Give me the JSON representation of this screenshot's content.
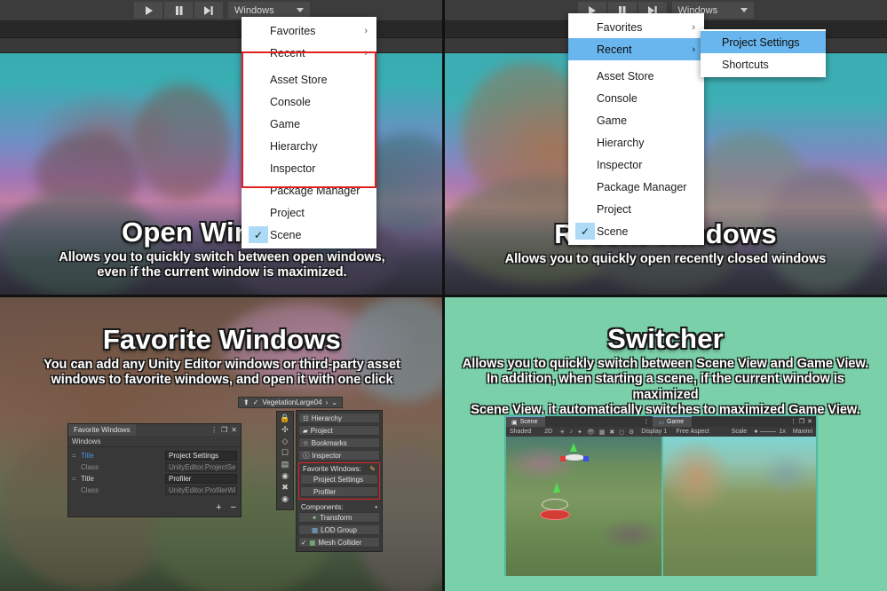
{
  "toolbar": {
    "play_label": "Play",
    "pause_label": "Pause",
    "step_label": "Step",
    "windows_button": "Windows"
  },
  "menus": {
    "open_windows": {
      "top_items": [
        {
          "label": "Favorites",
          "arrow": "›",
          "highlighted": false
        },
        {
          "label": "Recent",
          "arrow": "›",
          "highlighted": false
        }
      ],
      "window_items": [
        {
          "label": "Asset Store",
          "checked": false
        },
        {
          "label": "Console",
          "checked": false
        },
        {
          "label": "Game",
          "checked": false
        },
        {
          "label": "Hierarchy",
          "checked": false
        },
        {
          "label": "Inspector",
          "checked": false
        },
        {
          "label": "Package Manager",
          "checked": false
        },
        {
          "label": "Project",
          "checked": false
        },
        {
          "label": "Scene",
          "checked": true
        }
      ],
      "check_glyph": "✓",
      "highlight_color": "#69b6ef",
      "redbox_color": "#e02121"
    },
    "recent_windows": {
      "top_items": [
        {
          "label": "Favorites",
          "arrow": "›",
          "highlighted": false
        },
        {
          "label": "Recent",
          "arrow": "›",
          "highlighted": true
        }
      ],
      "window_items": [
        {
          "label": "Asset Store",
          "checked": false
        },
        {
          "label": "Console",
          "checked": false
        },
        {
          "label": "Game",
          "checked": false
        },
        {
          "label": "Hierarchy",
          "checked": false
        },
        {
          "label": "Inspector",
          "checked": false
        },
        {
          "label": "Package Manager",
          "checked": false
        },
        {
          "label": "Project",
          "checked": false
        },
        {
          "label": "Scene",
          "checked": true
        }
      ],
      "submenu": [
        {
          "label": "Project Settings",
          "highlighted": true
        },
        {
          "label": "Shortcuts",
          "highlighted": false
        }
      ]
    }
  },
  "panels": {
    "top_left": {
      "title": "Open Windows",
      "subtitle_line1": "Allows you to quickly switch between open windows,",
      "subtitle_line2": "even if the current window is maximized."
    },
    "top_right": {
      "title": "Recent Windows",
      "subtitle_line1": "Allows you to quickly open recently closed windows",
      "subtitle_line2": ""
    },
    "bottom_left": {
      "title": "Favorite Windows",
      "subtitle_line1": "You can add any Unity Editor windows or third-party asset",
      "subtitle_line2": "windows to favorite windows, and open it with one click"
    },
    "bottom_right": {
      "title": "Switcher",
      "subtitle_line1": "Allows you to quickly switch between Scene View and Game View.",
      "subtitle_line2": "In addition, when starting a scene, if the current window is maximized",
      "subtitle_line3": "Scene View, it automatically switches to maximized Game View.",
      "background_color": "#7ad0a8"
    }
  },
  "favorite_windows_panel": {
    "tab_title": "Favorite Windows",
    "menu_icon": "⋮",
    "maximize_icon": "❐",
    "close_icon": "✕",
    "section_label": "Windows",
    "rows": [
      {
        "key": "Title",
        "value": "Project Settings",
        "key_style": "title"
      },
      {
        "key": "Class",
        "value": "UnityEditor.ProjectSettin",
        "key_style": "class"
      },
      {
        "key": "Title",
        "value": "Profiler",
        "key_style": "title2"
      },
      {
        "key": "Class",
        "value": "UnityEditor.ProfilerWind",
        "key_style": "class"
      }
    ],
    "add_button": "+",
    "remove_button": "−"
  },
  "inspector_strip": {
    "object_bar": {
      "up_icon": "⬆",
      "check_icon": "✓",
      "name": "VegetationLarge04",
      "next_icon": "›",
      "chevron_icon": "⌄"
    },
    "buttons": [
      {
        "label": "Hierarchy",
        "glyph": "☷"
      },
      {
        "label": "Project",
        "glyph": "▰"
      },
      {
        "label": "Bookmarks",
        "glyph": "☆"
      },
      {
        "label": "Inspector",
        "glyph": "ⓘ"
      }
    ],
    "favorites_section_label": "Favorite Windows:",
    "favorites_edit_icon": "✎",
    "favorites_items": [
      {
        "label": "Project Settings"
      },
      {
        "label": "Profiler"
      }
    ],
    "components_section_label": "Components:",
    "components_dot": "•",
    "components": [
      {
        "label": "Transform",
        "glyph": "✦"
      },
      {
        "label": "LOD Group",
        "glyph": "▦"
      },
      {
        "label": "Mesh Collider",
        "glyph": "▦",
        "checked": true
      }
    ],
    "rail_icons": [
      "lock-icon",
      "move-icon",
      "rotate-icon",
      "scale-icon",
      "rect-icon",
      "transform-icon",
      "pivot-icon",
      "local-icon",
      "snap-icon",
      "settings-icon"
    ],
    "highlight_color": "#e02121"
  },
  "switcher_demo": {
    "scene_tab": {
      "label": "Scene",
      "icon": "▣"
    },
    "game_tab": {
      "label": "Game",
      "icon": "▭"
    },
    "scene_toolbar": [
      {
        "label": "Shaded"
      },
      {
        "label": "2D"
      }
    ],
    "game_toolbar": [
      {
        "label": "Display 1"
      },
      {
        "label": "Free Aspect"
      },
      {
        "label": "Scale"
      },
      {
        "label": "1x"
      },
      {
        "label": "Maximi"
      }
    ],
    "window_icons": {
      "menu": "⋮",
      "maximize": "❐",
      "close": "✕"
    },
    "border_color": "#52b9a0"
  }
}
